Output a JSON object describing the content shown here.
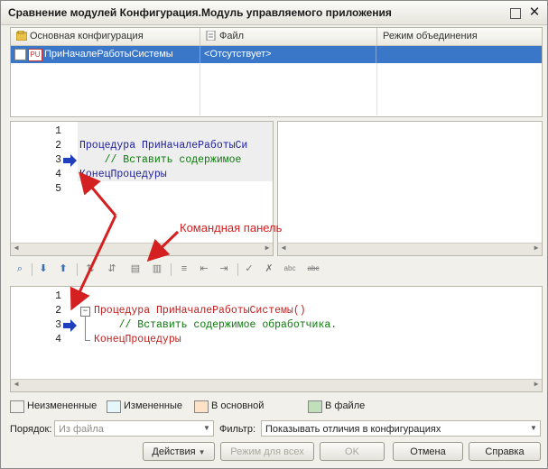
{
  "window": {
    "title": "Сравнение модулей Конфигурация.Модуль управляемого приложения",
    "maximize_label": "",
    "close_label": "✕"
  },
  "grid": {
    "columns": [
      "Основная конфигурация",
      "Файл",
      "Режим объединения"
    ],
    "rows": [
      {
        "main": "ПриНачалеРаботыСистемы",
        "file": "<Отсутствует>",
        "mode": "",
        "checked": false,
        "icon_text": "PU"
      }
    ]
  },
  "top_code": {
    "line_numbers": [
      "1",
      "2",
      "3",
      "4",
      "5"
    ],
    "lines": [
      "",
      "Процедура ПриНачалеРаботыСи",
      "    // Вставить содержимое",
      "КонецПроцедуры",
      ""
    ]
  },
  "bottom_code": {
    "line_numbers": [
      "1",
      "2",
      "3",
      "4"
    ],
    "lines": [
      "",
      "Процедура ПриНачалеРаботыСистемы()",
      "    // Вставить содержимое обработчика.",
      "КонецПроцедуры"
    ]
  },
  "annotation": "Командная панель",
  "toolbar_icons": [
    "find-icon",
    "down-arrow-icon",
    "up-arrow-icon",
    "compare-icon",
    "compare-blocks-icon",
    "copy-icon",
    "paste-icon",
    "indent-icon",
    "merge-left-icon",
    "merge-right-icon",
    "check-icon",
    "clear-check-icon",
    "abc-icon",
    "abc-strike-icon"
  ],
  "legend": {
    "unchanged": "Неизмененные",
    "changed": "Измененные",
    "in_main": "В основной",
    "in_file": "В файле",
    "colors": {
      "unchanged": "#ffffff",
      "changed": "#e6f7fb",
      "in_main": "#fde2c8",
      "in_file": "#bfe0ba"
    }
  },
  "order": {
    "label": "Порядок:",
    "value": "Из файла"
  },
  "filter": {
    "label": "Фильтр:",
    "value": "Показывать отличия в конфигурациях"
  },
  "buttons": {
    "actions": "Действия",
    "mode_all": "Режим для всех",
    "ok": "OK",
    "cancel": "Отмена",
    "help": "Справка"
  },
  "colors": {
    "selection": "#3a77c9",
    "annotation": "#d42020",
    "arrow": "#1f3fbf"
  }
}
